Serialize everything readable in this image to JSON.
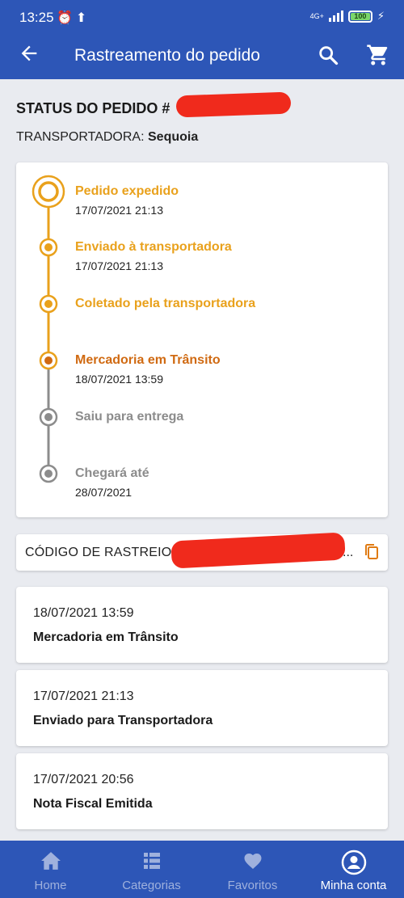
{
  "statusbar": {
    "time": "13:25",
    "network": "4G+",
    "battery": "100"
  },
  "appbar": {
    "title": "Rastreamento do pedido"
  },
  "order": {
    "status_label": "STATUS DO PEDIDO #",
    "carrier_label": "TRANSPORTADORA:",
    "carrier_name": "Sequoia"
  },
  "timeline": [
    {
      "label": "Pedido expedido",
      "date": "17/07/2021 21:13",
      "state": "current"
    },
    {
      "label": "Enviado à transportadora",
      "date": "17/07/2021 21:13",
      "state": "done"
    },
    {
      "label": "Coletado pela transportadora",
      "date": "",
      "state": "done"
    },
    {
      "label": "Mercadoria em Trânsito",
      "date": "18/07/2021 13:59",
      "state": "active"
    },
    {
      "label": "Saiu para entrega",
      "date": "",
      "state": "pending"
    },
    {
      "label": "Chegará até",
      "date": "28/07/2021",
      "state": "pending"
    }
  ],
  "tracking": {
    "label": "CÓDIGO DE RASTREIO:",
    "tail": "...",
    "copy_icon": "copy-icon"
  },
  "history": [
    {
      "date": "18/07/2021 13:59",
      "description": "Mercadoria em Trânsito"
    },
    {
      "date": "17/07/2021 21:13",
      "description": "Enviado para Transportadora"
    },
    {
      "date": "17/07/2021 20:56",
      "description": "Nota Fiscal Emitida"
    }
  ],
  "bottom_nav": [
    {
      "label": "Home",
      "icon": "home-icon"
    },
    {
      "label": "Categorias",
      "icon": "grid-icon"
    },
    {
      "label": "Favoritos",
      "icon": "heart-icon"
    },
    {
      "label": "Minha conta",
      "icon": "account-icon",
      "active": true
    }
  ],
  "colors": {
    "primary": "#2d56b7",
    "timeline_done": "#e9a11c",
    "timeline_active": "#d06a12",
    "timeline_pending": "#8c8c8c",
    "redaction": "#f02a1c"
  }
}
